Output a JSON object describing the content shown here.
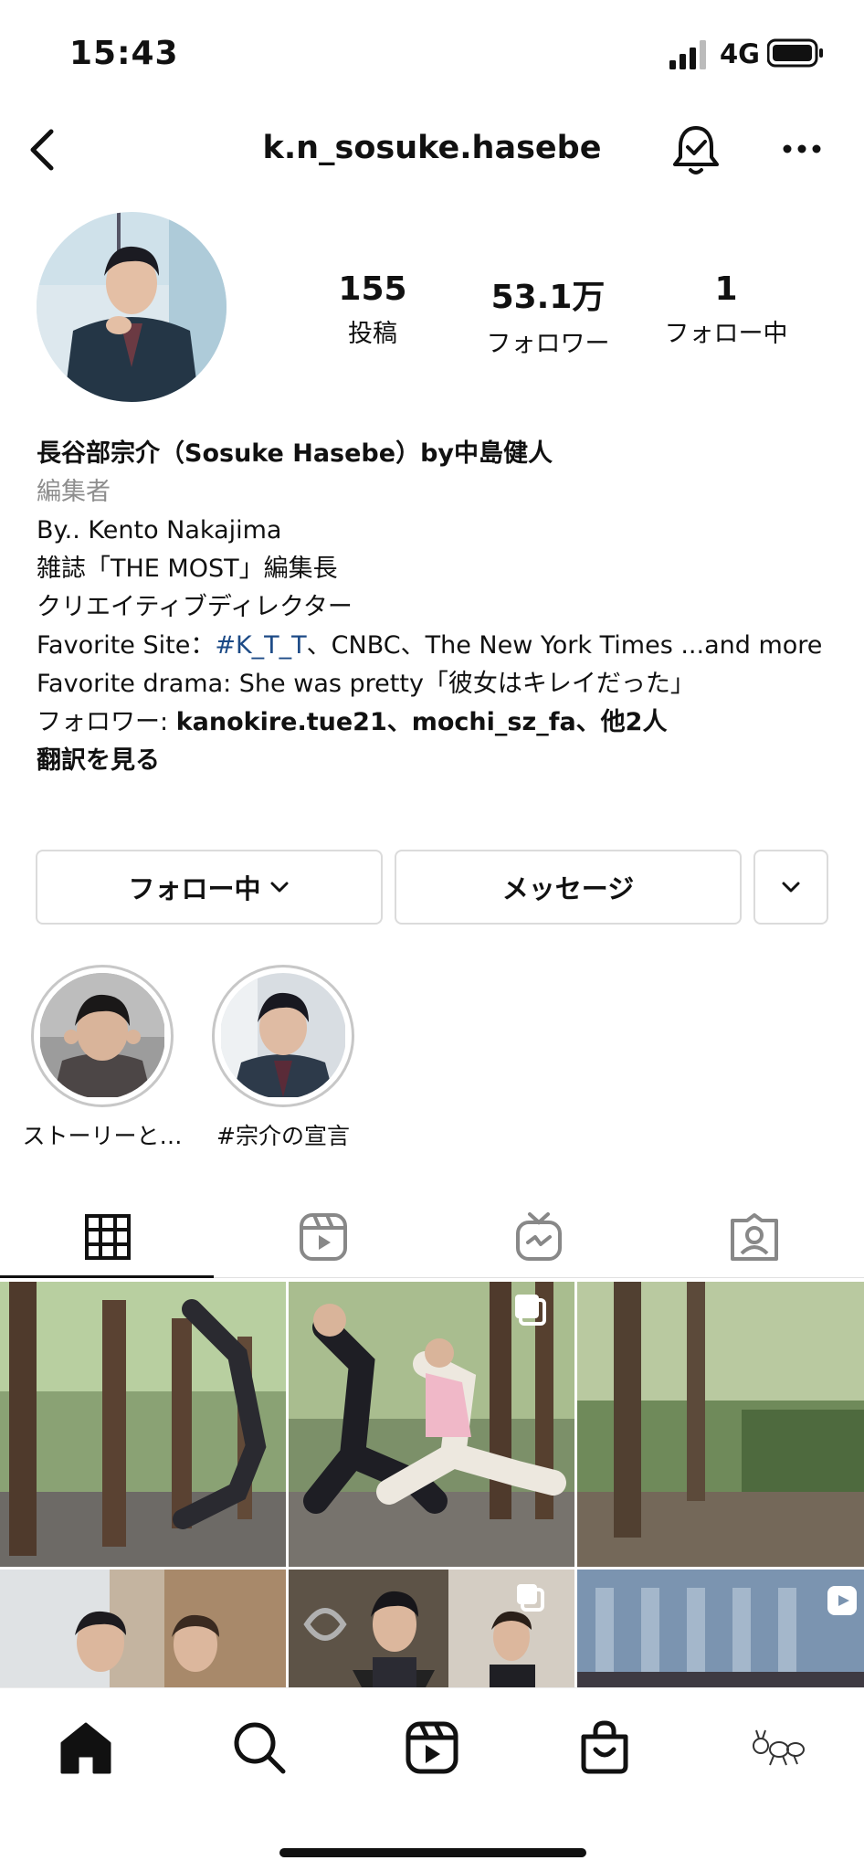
{
  "status_bar": {
    "time": "15:43",
    "network": "4G"
  },
  "header": {
    "username": "k.n_sosuke.hasebe"
  },
  "stats": [
    {
      "value": "155",
      "label": "投稿"
    },
    {
      "value": "53.1万",
      "label": "フォロワー"
    },
    {
      "value": "1",
      "label": "フォロー中"
    }
  ],
  "bio": {
    "name": "長谷部宗介（Sosuke Hasebe）by中島健人",
    "category": "編集者",
    "line1": "By.. Kento Nakajima",
    "line2": "雑誌「THE MOST」編集長",
    "line3": "クリエイティブディレクター",
    "site_prefix": "Favorite Site：",
    "site_link": "#K_T_T",
    "site_suffix": "、CNBC、The New York Times ...and more",
    "line5": "Favorite drama: She was pretty「彼女はキレイだった」",
    "followers_prefix": "フォロワー: ",
    "followers_names": "kanokire.tue21、mochi_sz_fa",
    "followers_suffix": "、他2人",
    "translate": "翻訳を見る"
  },
  "buttons": {
    "following": "フォロー中",
    "message": "メッセージ"
  },
  "highlights": [
    {
      "caption": "ストーリーと…"
    },
    {
      "caption": "#宗介の宣言"
    }
  ],
  "tabs": [
    {
      "icon": "grid-icon",
      "active": true
    },
    {
      "icon": "reels-icon",
      "active": false
    },
    {
      "icon": "igtv-icon",
      "active": false
    },
    {
      "icon": "tagged-icon",
      "active": false
    }
  ],
  "bottom_nav": [
    "home-icon",
    "search-icon",
    "reels-icon",
    "shop-icon",
    "profile-icon"
  ],
  "colors": {
    "link": "#1c4a86",
    "muted": "#8e8e8e",
    "border": "#dbdbdb"
  }
}
